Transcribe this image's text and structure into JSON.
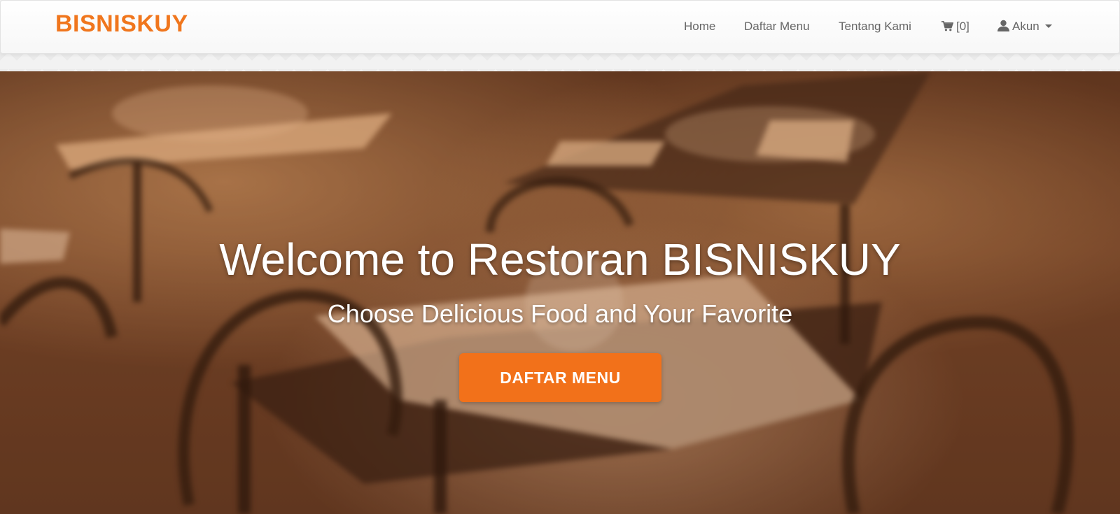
{
  "navbar": {
    "brand": "BISNISKUY",
    "items": [
      {
        "label": "Home"
      },
      {
        "label": "Daftar Menu"
      },
      {
        "label": "Tentang Kami"
      }
    ],
    "cart": {
      "label": "[0]",
      "icon": "shopping-cart-icon"
    },
    "account": {
      "label": "Akun",
      "icon": "user-icon"
    }
  },
  "hero": {
    "title": "Welcome to Restoran BISNISKUY",
    "subtitle": "Choose Delicious Food and Your Favorite",
    "button_label": "DAFTAR MENU"
  },
  "colors": {
    "accent": "#f2711a",
    "nav_text": "#666666"
  }
}
